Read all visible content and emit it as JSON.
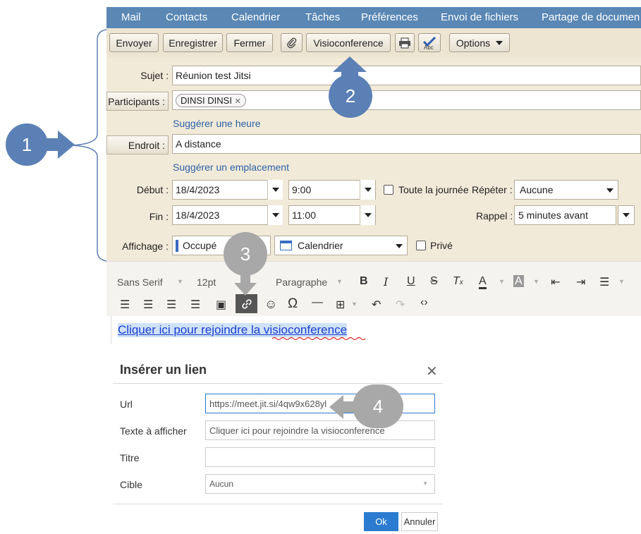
{
  "nav": [
    "Mail",
    "Contacts",
    "Calendrier",
    "Tâches",
    "Préférences",
    "Envoi de fichiers",
    "Partage de documen"
  ],
  "toolbar": {
    "send": "Envoyer",
    "save": "Enregistrer",
    "close": "Fermer",
    "attach_icon": "paperclip-icon",
    "visio": "Visioconference",
    "print_icon": "printer-icon",
    "spell_icon": "spellcheck-icon",
    "options": "Options"
  },
  "form": {
    "subject_label": "Sujet :",
    "subject_value": "Réunion test Jitsi",
    "participants_label": "Participants :",
    "participant_chip": "DINSI DINSI",
    "suggest_time": "Suggérer une heure",
    "location_label": "Endroit :",
    "location_value": "A distance",
    "suggest_location": "Suggérer un emplacement",
    "start_label": "Début :",
    "start_date": "18/4/2023",
    "start_time": "9:00",
    "all_day_label": "Toute la journée",
    "repeat_label": "Répéter :",
    "repeat_value": "Aucune",
    "end_label": "Fin :",
    "end_date": "18/4/2023",
    "end_time": "11:00",
    "reminder_label": "Rappel :",
    "reminder_value": "5 minutes avant",
    "display_label": "Affichage :",
    "display_value": "Occupé",
    "calendar_value": "Calendrier",
    "private_label": "Privé"
  },
  "editor": {
    "font": "Sans Serif",
    "size": "12pt",
    "block": "Paragraphe",
    "body_link": "Cliquer ici pour rejoindre la visioconference"
  },
  "callouts": [
    "1",
    "2",
    "3",
    "4"
  ],
  "dialog": {
    "title": "Insérer un lien",
    "url_label": "Url",
    "url_value": "https://meet.jit.si/4qw9x628yl",
    "text_label": "Texte à afficher",
    "text_value": "Cliquer ici pour rejoindre la visioconference",
    "title_label": "Titre",
    "target_label": "Cible",
    "target_value": "Aucun",
    "ok": "Ok",
    "cancel": "Annuler"
  },
  "colors": {
    "nav": "#5a87b4",
    "panel": "#f2ead9",
    "callout_blue": "#5b80b5",
    "callout_grey": "#a8a8a8",
    "ok_button": "#2b7bd0"
  }
}
